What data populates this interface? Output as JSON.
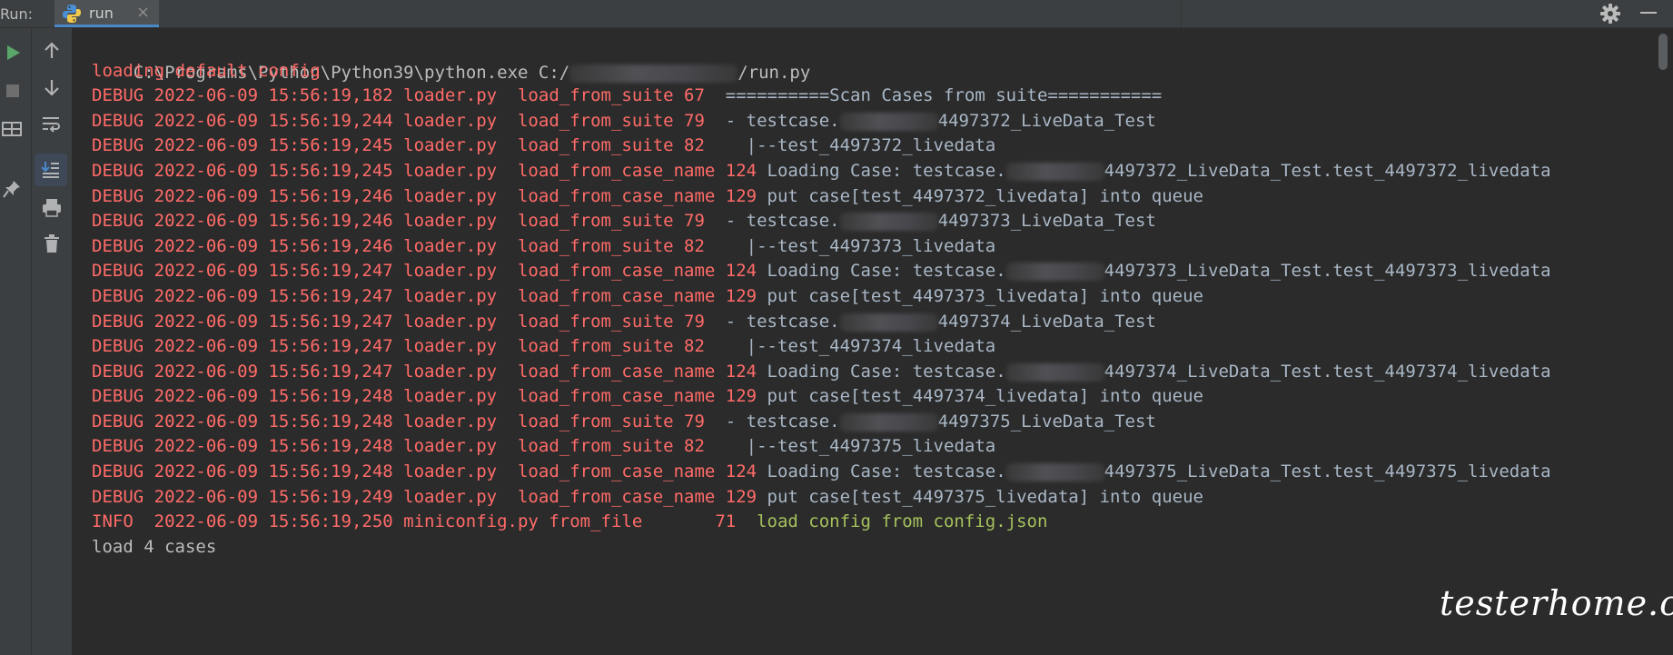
{
  "toolwindow": {
    "run_label": "Run:",
    "tab_label": "run",
    "tab_close": "×"
  },
  "console_lines": [
    {
      "type": "cmd",
      "parts": [
        "C:\\Programs\\Python\\Python39\\python.exe C:/",
        "/run.py"
      ]
    },
    {
      "type": "stderr",
      "text": "loading default config"
    },
    {
      "type": "debug",
      "prefix": "DEBUG 2022-06-09 15:56:19,182 loader.py  load_from_suite 67  ",
      "msg": "==========Scan Cases from suite==========="
    },
    {
      "type": "debug",
      "prefix": "DEBUG 2022-06-09 15:56:19,244 loader.py  load_from_suite 79  ",
      "msg_pre": "- testcase.",
      "msg_post": "4497372_LiveData_Test"
    },
    {
      "type": "debug",
      "prefix": "DEBUG 2022-06-09 15:56:19,245 loader.py  load_from_suite 82  ",
      "msg": "  |--test_4497372_livedata"
    },
    {
      "type": "debug",
      "prefix": "DEBUG 2022-06-09 15:56:19,245 loader.py  load_from_case_name 124 ",
      "msg_pre": "Loading Case: testcase.",
      "msg_post": "4497372_LiveData_Test.test_4497372_livedata"
    },
    {
      "type": "debug",
      "prefix": "DEBUG 2022-06-09 15:56:19,246 loader.py  load_from_case_name 129 ",
      "msg": "put case[test_4497372_livedata] into queue"
    },
    {
      "type": "debug",
      "prefix": "DEBUG 2022-06-09 15:56:19,246 loader.py  load_from_suite 79  ",
      "msg_pre": "- testcase.",
      "msg_post": "4497373_LiveData_Test"
    },
    {
      "type": "debug",
      "prefix": "DEBUG 2022-06-09 15:56:19,246 loader.py  load_from_suite 82  ",
      "msg": "  |--test_4497373_livedata"
    },
    {
      "type": "debug",
      "prefix": "DEBUG 2022-06-09 15:56:19,247 loader.py  load_from_case_name 124 ",
      "msg_pre": "Loading Case: testcase.",
      "msg_post": "4497373_LiveData_Test.test_4497373_livedata"
    },
    {
      "type": "debug",
      "prefix": "DEBUG 2022-06-09 15:56:19,247 loader.py  load_from_case_name 129 ",
      "msg": "put case[test_4497373_livedata] into queue"
    },
    {
      "type": "debug",
      "prefix": "DEBUG 2022-06-09 15:56:19,247 loader.py  load_from_suite 79  ",
      "msg_pre": "- testcase.",
      "msg_post": "4497374_LiveData_Test"
    },
    {
      "type": "debug",
      "prefix": "DEBUG 2022-06-09 15:56:19,247 loader.py  load_from_suite 82  ",
      "msg": "  |--test_4497374_livedata"
    },
    {
      "type": "debug",
      "prefix": "DEBUG 2022-06-09 15:56:19,247 loader.py  load_from_case_name 124 ",
      "msg_pre": "Loading Case: testcase.",
      "msg_post": "4497374_LiveData_Test.test_4497374_livedata"
    },
    {
      "type": "debug",
      "prefix": "DEBUG 2022-06-09 15:56:19,248 loader.py  load_from_case_name 129 ",
      "msg": "put case[test_4497374_livedata] into queue"
    },
    {
      "type": "debug",
      "prefix": "DEBUG 2022-06-09 15:56:19,248 loader.py  load_from_suite 79  ",
      "msg_pre": "- testcase.",
      "msg_post": "4497375_LiveData_Test"
    },
    {
      "type": "debug",
      "prefix": "DEBUG 2022-06-09 15:56:19,248 loader.py  load_from_suite 82  ",
      "msg": "  |--test_4497375_livedata"
    },
    {
      "type": "debug",
      "prefix": "DEBUG 2022-06-09 15:56:19,248 loader.py  load_from_case_name 124 ",
      "msg_pre": "Loading Case: testcase.",
      "msg_post": "4497375_LiveData_Test.test_4497375_livedata"
    },
    {
      "type": "debug",
      "prefix": "DEBUG 2022-06-09 15:56:19,249 loader.py  load_from_case_name 129 ",
      "msg": "put case[test_4497375_livedata] into queue"
    },
    {
      "type": "info",
      "prefix": "INFO  2022-06-09 15:56:19,250 miniconfig.py from_file       71  ",
      "msg": "load config from config.json"
    },
    {
      "type": "plain",
      "text": "load 4 cases"
    }
  ],
  "watermark": "testerhome.com",
  "colors": {
    "accent": "#4a88c7",
    "debug": "#ff6b68",
    "message": "#a9b7c6",
    "info_message": "#a5c25c",
    "plain": "#bcbcbc"
  },
  "icons": {
    "sidebar_left": [
      "rerun-icon",
      "stop-icon",
      "restore-layout-icon",
      "pin-tab-icon"
    ],
    "sidebar_right": [
      "up-arrow-icon",
      "down-arrow-icon",
      "soft-wrap-icon",
      "scroll-to-end-icon",
      "print-icon",
      "clear-all-icon"
    ],
    "topbar": [
      "python-icon",
      "gear-icon",
      "minimize-icon"
    ]
  }
}
